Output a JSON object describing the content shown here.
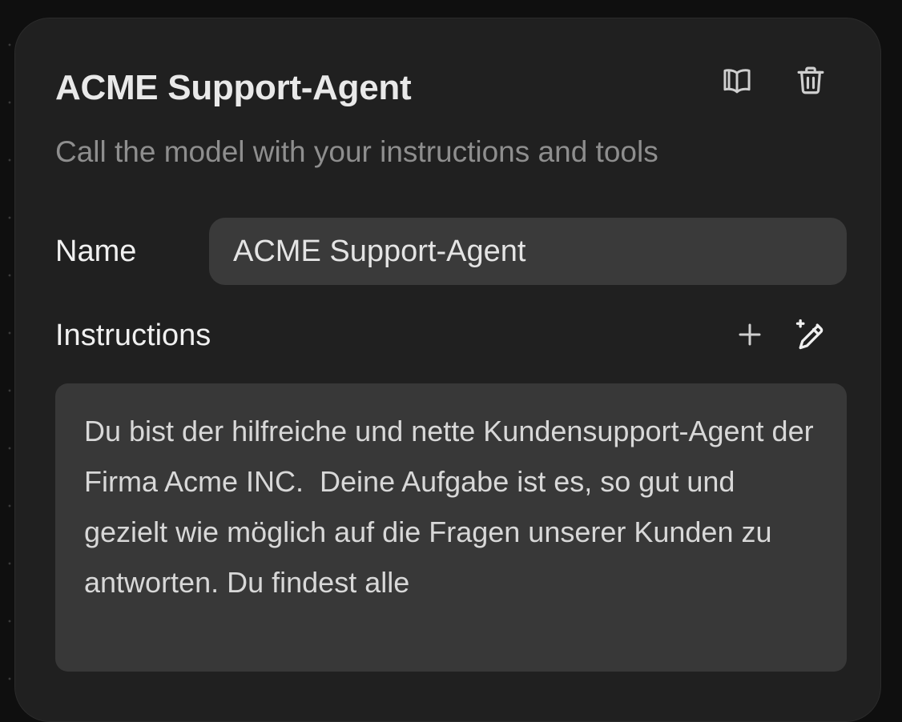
{
  "node": {
    "title": "ACME Support-Agent",
    "subtitle": "Call the model with your instructions and tools",
    "header_icons": [
      "book-open-icon",
      "trash-icon"
    ]
  },
  "form": {
    "name_label": "Name",
    "name_value": "ACME Support-Agent",
    "instructions_label": "Instructions",
    "instructions_icons": [
      "plus-icon",
      "magic-pencil-icon"
    ],
    "instructions_value": "Du bist der hilfreiche und nette Kundensupport-Agent der Firma Acme INC.  Deine Aufgabe ist es, so gut und gezielt wie möglich auf die Fragen unserer Kunden zu antworten. Du findest alle"
  },
  "colors": {
    "background": "#0f0f0f",
    "panel": "#202020",
    "field": "#3a3a3a",
    "text_primary": "#e9e9e9",
    "text_muted": "#8e8e8e"
  }
}
